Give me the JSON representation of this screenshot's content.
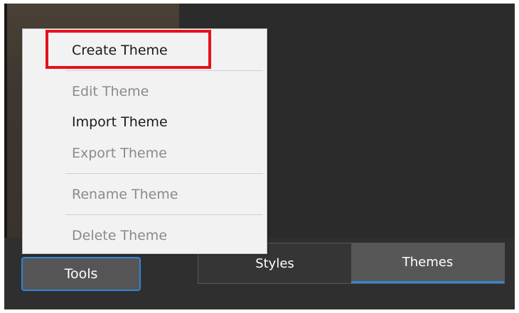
{
  "menu": {
    "items": [
      {
        "label": "Create Theme",
        "enabled": true
      },
      {
        "label": "Edit Theme",
        "enabled": false
      },
      {
        "label": "Import Theme",
        "enabled": true
      },
      {
        "label": "Export Theme",
        "enabled": false
      },
      {
        "label": "Rename Theme",
        "enabled": false
      },
      {
        "label": "Delete Theme",
        "enabled": false
      }
    ]
  },
  "toolbar": {
    "tools_label": "Tools"
  },
  "tabs": [
    {
      "label": "Styles",
      "active": false
    },
    {
      "label": "Themes",
      "active": true
    }
  ],
  "colors": {
    "accent": "#2f86d8",
    "highlight": "#e8101c",
    "menu_bg": "#f2f2f2",
    "panel_bg": "#2b2b2b"
  }
}
